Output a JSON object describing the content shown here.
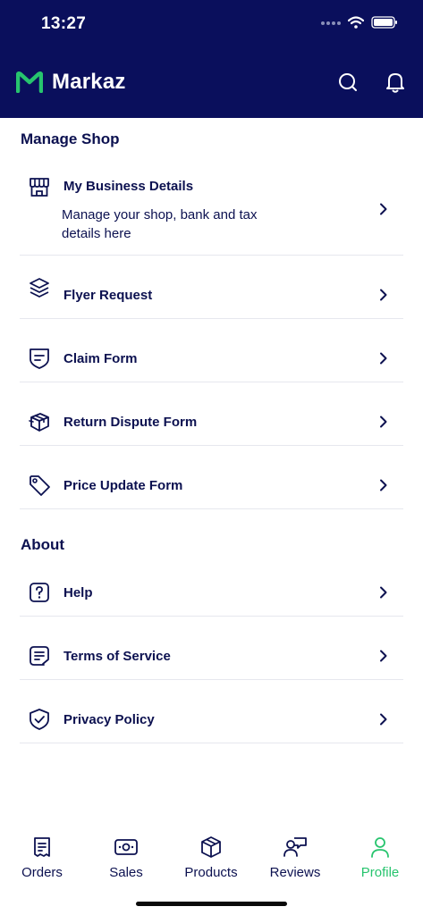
{
  "status_bar": {
    "time": "13:27"
  },
  "header": {
    "brand": "Markaz"
  },
  "manage_shop": {
    "title": "Manage Shop",
    "items": [
      {
        "label": "My Business Details",
        "description": "Manage your shop, bank and tax details here"
      },
      {
        "label": "Flyer Request"
      },
      {
        "label": "Claim Form"
      },
      {
        "label": "Return Dispute Form"
      },
      {
        "label": "Price Update Form"
      }
    ]
  },
  "about": {
    "title": "About",
    "items": [
      {
        "label": "Help"
      },
      {
        "label": "Terms of Service"
      },
      {
        "label": "Privacy Policy"
      }
    ]
  },
  "tabs": [
    {
      "label": "Orders"
    },
    {
      "label": "Sales"
    },
    {
      "label": "Products"
    },
    {
      "label": "Reviews"
    },
    {
      "label": "Profile",
      "active": true
    }
  ],
  "colors": {
    "header": "#0a0f5c",
    "brand_green": "#27c46e",
    "text": "#0c1150"
  }
}
